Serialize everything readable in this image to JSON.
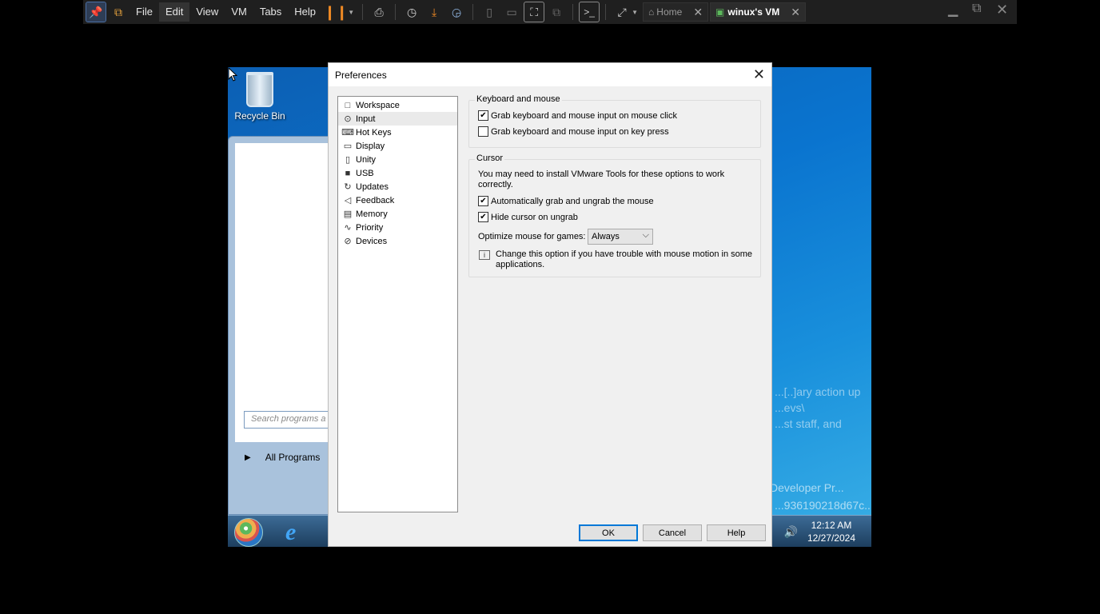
{
  "toolbar": {
    "menus": [
      "File",
      "Edit",
      "View",
      "VM",
      "Tabs",
      "Help"
    ],
    "tabs": [
      {
        "label": "Home",
        "current": false
      },
      {
        "label": "winux's VM",
        "current": true
      }
    ],
    "icons": [
      "pin-icon",
      "vmware-logo-icon",
      "pause-icon",
      "send-ctrl-alt-del-icon",
      "snapshot-icon",
      "revert-snapshot-icon",
      "snapshot-manager-icon",
      "console-view-icon",
      "full-screen-icon",
      "unity-icon",
      "terminal-icon",
      "stretch-icon"
    ],
    "accent": "#4a6fa5"
  },
  "guest": {
    "recycle_bin_label": "Recycle Bin",
    "start_menu": {
      "all_programs": "All Programs",
      "search_placeholder": "Search programs a"
    },
    "watermark_lines": [
      "...[..]ary action up",
      "...evs\\",
      "...st staff, and",
      "Developer Pr...",
      "...936190218d67c..."
    ],
    "clock": {
      "time": "12:12 AM",
      "date": "12/27/2024"
    }
  },
  "dialog": {
    "title": "Preferences",
    "nav_items": [
      {
        "label": "Workspace",
        "icon": "workspace-icon",
        "selected": false
      },
      {
        "label": "Input",
        "icon": "mouse-icon",
        "selected": true
      },
      {
        "label": "Hot Keys",
        "icon": "keyboard-icon",
        "selected": false
      },
      {
        "label": "Display",
        "icon": "monitor-icon",
        "selected": false
      },
      {
        "label": "Unity",
        "icon": "unity-icon",
        "selected": false
      },
      {
        "label": "USB",
        "icon": "usb-icon",
        "selected": false
      },
      {
        "label": "Updates",
        "icon": "refresh-icon",
        "selected": false
      },
      {
        "label": "Feedback",
        "icon": "megaphone-icon",
        "selected": false
      },
      {
        "label": "Memory",
        "icon": "memory-icon",
        "selected": false
      },
      {
        "label": "Priority",
        "icon": "priority-icon",
        "selected": false
      },
      {
        "label": "Devices",
        "icon": "devices-icon",
        "selected": false
      }
    ],
    "keyboard_mouse": {
      "label": "Keyboard and mouse",
      "grab_on_click": {
        "label": "Grab keyboard and mouse input on mouse click",
        "checked": true
      },
      "grab_on_key": {
        "label": "Grab keyboard and mouse input on key press",
        "checked": false
      }
    },
    "cursor": {
      "label": "Cursor",
      "note_line1": "You may need to install VMware Tools for these options to work",
      "note_line2": "correctly.",
      "auto_grab": {
        "label": "Automatically grab and ungrab the mouse",
        "checked": true
      },
      "hide_cursor": {
        "label": "Hide cursor on ungrab",
        "checked": true
      },
      "optimize_label": "Optimize mouse for games:",
      "optimize_value": "Always",
      "info_line1": "Change this option if you have trouble with mouse motion in some",
      "info_line2": "applications."
    },
    "buttons": {
      "ok": "OK",
      "cancel": "Cancel",
      "help": "Help"
    }
  }
}
